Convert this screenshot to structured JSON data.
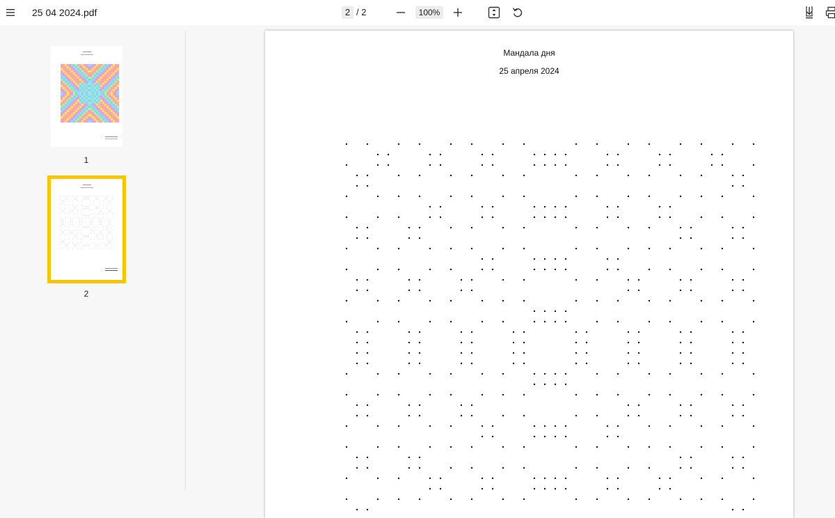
{
  "toolbar": {
    "menu_icon": "hamburger-menu-icon",
    "title": "25 04 2024.pdf",
    "current_page": "2",
    "page_separator": "/ 2",
    "zoom_out_icon": "minus-icon",
    "zoom": "100%",
    "zoom_in_icon": "plus-icon",
    "fit_icon": "fit-page-icon",
    "rotate_icon": "rotate-icon",
    "download_icon": "download-icon",
    "print_icon": "print-icon"
  },
  "sidebar": {
    "thumbnails": [
      {
        "label": "1",
        "selected": false
      },
      {
        "label": "2",
        "selected": true
      }
    ],
    "selection_color": "#f7c600"
  },
  "document": {
    "heading": "Мандала дня",
    "date": "25 апреля 2024"
  }
}
